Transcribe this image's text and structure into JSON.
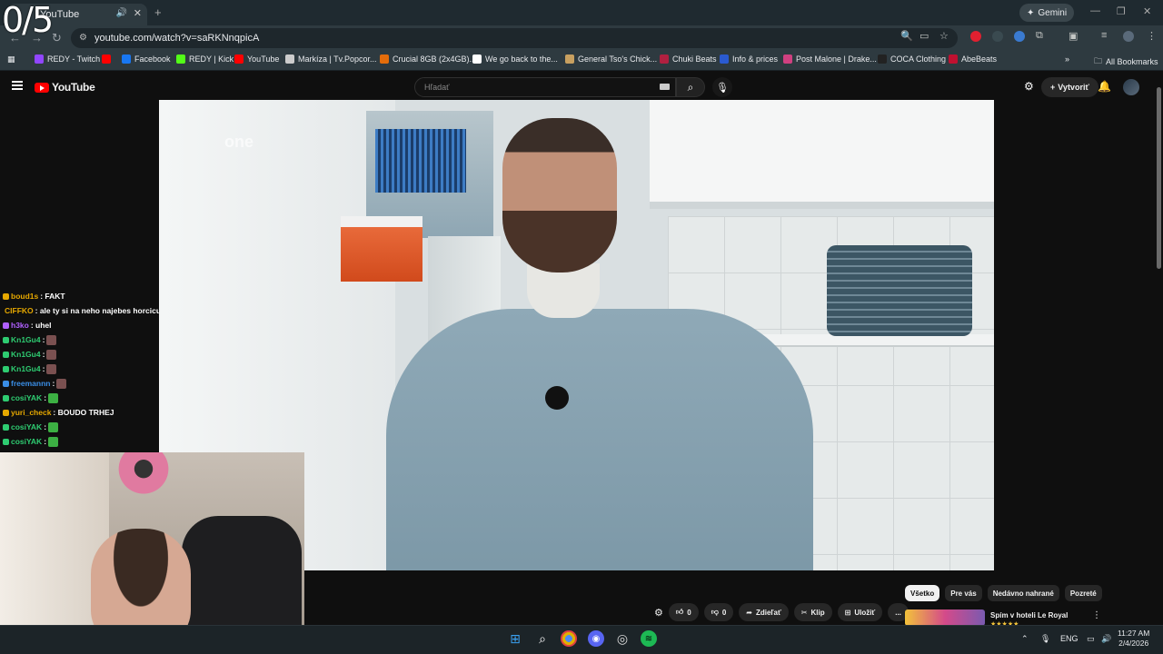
{
  "overlay": {
    "counter": "0/5"
  },
  "browser": {
    "tab_title": "YouTube",
    "new_tab": "+",
    "gemini_label": "Gemini",
    "url": "youtube.com/watch?v=saRKNnqpicA",
    "bookmarks": [
      {
        "label": "REDY - Twitch",
        "color": "#9146ff"
      },
      {
        "label": "",
        "color": "#ff0000"
      },
      {
        "label": "Facebook",
        "color": "#1877f2"
      },
      {
        "label": "REDY | Kick",
        "color": "#53fc18"
      },
      {
        "label": "YouTube",
        "color": "#ff0000"
      },
      {
        "label": "Markíza | Tv.Popcor...",
        "color": "#cccccc"
      },
      {
        "label": "Crucial 8GB (2x4GB)...",
        "color": "#e46c0a"
      },
      {
        "label": "We go back to the...",
        "color": "#ffffff"
      },
      {
        "label": "General Tso's Chick...",
        "color": "#c8a060"
      },
      {
        "label": "Chuki Beats",
        "color": "#b02040"
      },
      {
        "label": "Info & prices",
        "color": "#2a5ad0"
      },
      {
        "label": "Post Malone | Drake...",
        "color": "#d04080"
      },
      {
        "label": "COCA Clothing",
        "color": "#222222"
      },
      {
        "label": "AbeBeats",
        "color": "#c01030"
      }
    ],
    "all_bookmarks": "All Bookmarks"
  },
  "youtube": {
    "logo_text": "YouTube",
    "search_placeholder": "Hľadať",
    "create_label": "Vytvoriť",
    "watermark": "one",
    "chips": [
      "Všetko",
      "Pre vás",
      "Nedávno nahrané",
      "Pozreté"
    ],
    "actions": {
      "like_count": "0",
      "dislike_count": "0",
      "share": "Zdieľať",
      "clip": "Klip",
      "save": "Uložiť",
      "more": "..."
    },
    "recommended": {
      "title": "Spím v hoteli Le Royal",
      "stars": "★★★★★"
    }
  },
  "chat": [
    {
      "user": "boud1s",
      "color": "#e6a800",
      "message": ": FAKT",
      "emote": false
    },
    {
      "user": "CIFFKO",
      "color": "#e6a800",
      "message": ": ale ty si na neho najebes horcicu",
      "emote": false
    },
    {
      "user": "h3ko",
      "color": "#b060ff",
      "message": ": uhel",
      "emote": false
    },
    {
      "user": "Kn1Gu4",
      "color": "#2ecc71",
      "message": ":",
      "emote": true
    },
    {
      "user": "Kn1Gu4",
      "color": "#2ecc71",
      "message": ":",
      "emote": true
    },
    {
      "user": "Kn1Gu4",
      "color": "#2ecc71",
      "message": ":",
      "emote": true
    },
    {
      "user": "freemannn",
      "color": "#3a8ee6",
      "message": ":",
      "emote": true
    },
    {
      "user": "cosiYAK",
      "color": "#2ecc71",
      "message": ":",
      "emote": true
    },
    {
      "user": "yuri_check",
      "color": "#e6a800",
      "message": ": BOUDO TRHEJ",
      "emote": false
    },
    {
      "user": "cosiYAK",
      "color": "#2ecc71",
      "message": ":",
      "emote": true
    },
    {
      "user": "cosiYAK",
      "color": "#2ecc71",
      "message": ":",
      "emote": true
    }
  ],
  "taskbar": {
    "language": "ENG",
    "time": "11:27 AM",
    "date": "2/4/2026"
  }
}
